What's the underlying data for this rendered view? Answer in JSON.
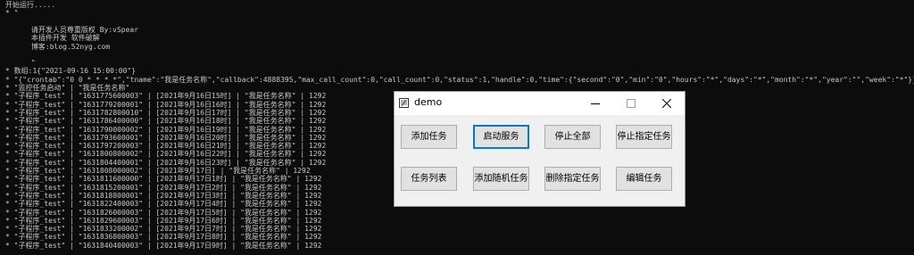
{
  "console": {
    "lines": [
      "开始运行.....",
      "* \"",
      "",
      "      请开发人员尊重版权 By:vSpear",
      "      本插件开发 软件破解",
      "      博客:blog.52nyg.com",
      "",
      "      \"",
      "* 数组:1{\"2021-09-16 15:00:00\"}",
      "* \"{\"crontab\":\"0 0 * * * *\",\"tname\":\"我是任务名称\",\"callback\":4888395,\"max_call_count\":0,\"call_count\":0,\"status\":1,\"handle\":0,\"time\":{\"second\":\"0\",\"min\":\"0\",\"hours\":\"*\",\"days\":\"*\",\"month\":\"*\",\"year\":\"\",\"week\":\"*\"}}\"",
      "* \"监控任务启动\" | \"我是任务名称\"",
      "* \"子程序_test\" | \"1631775600003\" | [2021年9月16日15时] | \"我是任务名称\" | 1292",
      "* \"子程序_test\" | \"1631779200001\" | [2021年9月16日16时] | \"我是任务名称\" | 1292",
      "* \"子程序_test\" | \"1631782800010\" | [2021年9月16日17时] | \"我是任务名称\" | 1292",
      "* \"子程序_test\" | \"1631786400000\" | [2021年9月16日18时] | \"我是任务名称\" | 1292",
      "* \"子程序_test\" | \"1631790000002\" | [2021年9月16日19时] | \"我是任务名称\" | 1292",
      "* \"子程序_test\" | \"1631793600001\" | [2021年9月16日20时] | \"我是任务名称\" | 1292",
      "* \"子程序_test\" | \"1631797200003\" | [2021年9月16日21时] | \"我是任务名称\" | 1292",
      "* \"子程序_test\" | \"1631800800002\" | [2021年9月16日22时] | \"我是任务名称\" | 1292",
      "* \"子程序_test\" | \"1631804400001\" | [2021年9月16日23时] | \"我是任务名称\" | 1292",
      "* \"子程序_test\" | \"1631808000002\" | [2021年9月17日] | \"我是任务名称\" | 1292",
      "* \"子程序_test\" | \"1631811600000\" | [2021年9月17日1时] | \"我是任务名称\" | 1292",
      "* \"子程序_test\" | \"1631815200001\" | [2021年9月17日2时] | \"我是任务名称\" | 1292",
      "* \"子程序_test\" | \"1631818800001\" | [2021年9月17日3时] | \"我是任务名称\" | 1292",
      "* \"子程序_test\" | \"1631822400003\" | [2021年9月17日4时] | \"我是任务名称\" | 1292",
      "* \"子程序_test\" | \"1631826000003\" | [2021年9月17日5时] | \"我是任务名称\" | 1292",
      "* \"子程序_test\" | \"1631829600003\" | [2021年9月17日6时] | \"我是任务名称\" | 1292",
      "* \"子程序_test\" | \"1631833200002\" | [2021年9月17日7时] | \"我是任务名称\" | 1292",
      "* \"子程序_test\" | \"1631836800003\" | [2021年9月17日8时] | \"我是任务名称\" | 1292",
      "* \"子程序_test\" | \"1631840400003\" | [2021年9月17日9时] | \"我是任务名称\" | 1292"
    ]
  },
  "dialog": {
    "title": "demo",
    "icon": "app-window-icon",
    "controls": {
      "minimize": "minimize-icon",
      "maximize": "maximize-icon",
      "close": "close-icon"
    },
    "buttons": {
      "add_task": "添加任务",
      "start_service": "启动服务",
      "stop_all": "停止全部",
      "stop_specified": "停止指定任务",
      "task_list": "任务列表",
      "add_random": "添加随机任务",
      "delete_specified": "删除指定任务",
      "edit_task": "编辑任务"
    }
  },
  "colors": {
    "console_bg": "#0c0c0c",
    "console_text": "#c8c8c8",
    "dialog_bg": "#f0f0f0",
    "focus": "#0078d7"
  }
}
